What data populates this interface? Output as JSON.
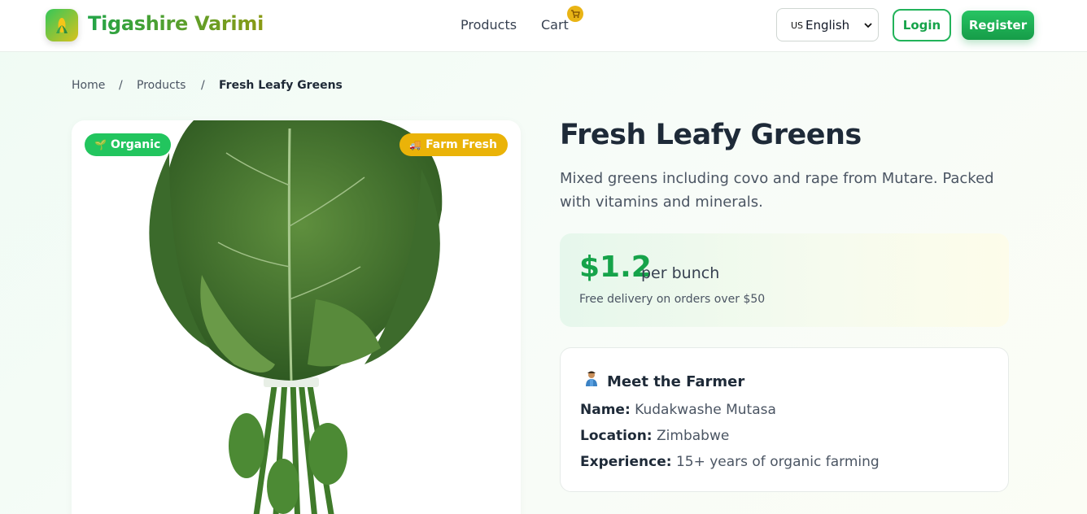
{
  "header": {
    "brand": "Tigashire Varimi",
    "nav": {
      "products": "Products",
      "cart": "Cart"
    },
    "language": {
      "flag": "US",
      "selected": "English"
    },
    "login_label": "Login",
    "register_label": "Register"
  },
  "breadcrumb": {
    "home": "Home",
    "products": "Products",
    "current": "Fresh Leafy Greens",
    "separator": "/"
  },
  "product": {
    "badges": {
      "organic": "Organic",
      "fresh": "Farm Fresh"
    },
    "title": "Fresh Leafy Greens",
    "description": "Mixed greens including covo and rape from Mutare. Packed with vitamins and minerals.",
    "price": "$1.2",
    "unit": "per bunch",
    "delivery_note": "Free delivery on orders over $50"
  },
  "farmer": {
    "heading": "Meet the Farmer",
    "name_label": "Name:",
    "name": "Kudakwashe Mutasa",
    "location_label": "Location:",
    "location": "Zimbabwe",
    "experience_label": "Experience:",
    "experience": "15+ years of organic farming"
  },
  "colors": {
    "brand_green": "#16a34a",
    "badge_yellow": "#eab308"
  }
}
